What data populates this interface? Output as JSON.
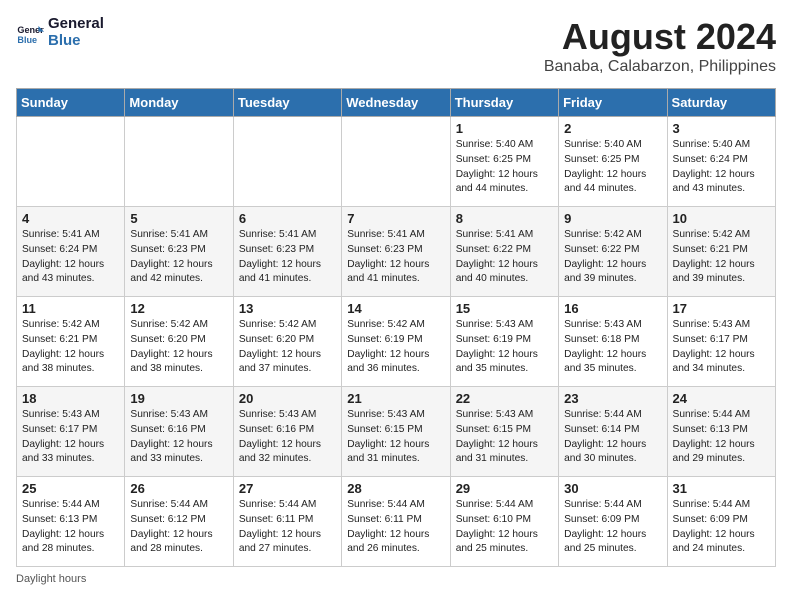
{
  "logo": {
    "line1": "General",
    "line2": "Blue"
  },
  "title": "August 2024",
  "subtitle": "Banaba, Calabarzon, Philippines",
  "footer": "Daylight hours",
  "days_of_week": [
    "Sunday",
    "Monday",
    "Tuesday",
    "Wednesday",
    "Thursday",
    "Friday",
    "Saturday"
  ],
  "weeks": [
    [
      {
        "day": "",
        "info": ""
      },
      {
        "day": "",
        "info": ""
      },
      {
        "day": "",
        "info": ""
      },
      {
        "day": "",
        "info": ""
      },
      {
        "day": "1",
        "info": "Sunrise: 5:40 AM\nSunset: 6:25 PM\nDaylight: 12 hours\nand 44 minutes."
      },
      {
        "day": "2",
        "info": "Sunrise: 5:40 AM\nSunset: 6:25 PM\nDaylight: 12 hours\nand 44 minutes."
      },
      {
        "day": "3",
        "info": "Sunrise: 5:40 AM\nSunset: 6:24 PM\nDaylight: 12 hours\nand 43 minutes."
      }
    ],
    [
      {
        "day": "4",
        "info": "Sunrise: 5:41 AM\nSunset: 6:24 PM\nDaylight: 12 hours\nand 43 minutes."
      },
      {
        "day": "5",
        "info": "Sunrise: 5:41 AM\nSunset: 6:23 PM\nDaylight: 12 hours\nand 42 minutes."
      },
      {
        "day": "6",
        "info": "Sunrise: 5:41 AM\nSunset: 6:23 PM\nDaylight: 12 hours\nand 41 minutes."
      },
      {
        "day": "7",
        "info": "Sunrise: 5:41 AM\nSunset: 6:23 PM\nDaylight: 12 hours\nand 41 minutes."
      },
      {
        "day": "8",
        "info": "Sunrise: 5:41 AM\nSunset: 6:22 PM\nDaylight: 12 hours\nand 40 minutes."
      },
      {
        "day": "9",
        "info": "Sunrise: 5:42 AM\nSunset: 6:22 PM\nDaylight: 12 hours\nand 39 minutes."
      },
      {
        "day": "10",
        "info": "Sunrise: 5:42 AM\nSunset: 6:21 PM\nDaylight: 12 hours\nand 39 minutes."
      }
    ],
    [
      {
        "day": "11",
        "info": "Sunrise: 5:42 AM\nSunset: 6:21 PM\nDaylight: 12 hours\nand 38 minutes."
      },
      {
        "day": "12",
        "info": "Sunrise: 5:42 AM\nSunset: 6:20 PM\nDaylight: 12 hours\nand 38 minutes."
      },
      {
        "day": "13",
        "info": "Sunrise: 5:42 AM\nSunset: 6:20 PM\nDaylight: 12 hours\nand 37 minutes."
      },
      {
        "day": "14",
        "info": "Sunrise: 5:42 AM\nSunset: 6:19 PM\nDaylight: 12 hours\nand 36 minutes."
      },
      {
        "day": "15",
        "info": "Sunrise: 5:43 AM\nSunset: 6:19 PM\nDaylight: 12 hours\nand 35 minutes."
      },
      {
        "day": "16",
        "info": "Sunrise: 5:43 AM\nSunset: 6:18 PM\nDaylight: 12 hours\nand 35 minutes."
      },
      {
        "day": "17",
        "info": "Sunrise: 5:43 AM\nSunset: 6:17 PM\nDaylight: 12 hours\nand 34 minutes."
      }
    ],
    [
      {
        "day": "18",
        "info": "Sunrise: 5:43 AM\nSunset: 6:17 PM\nDaylight: 12 hours\nand 33 minutes."
      },
      {
        "day": "19",
        "info": "Sunrise: 5:43 AM\nSunset: 6:16 PM\nDaylight: 12 hours\nand 33 minutes."
      },
      {
        "day": "20",
        "info": "Sunrise: 5:43 AM\nSunset: 6:16 PM\nDaylight: 12 hours\nand 32 minutes."
      },
      {
        "day": "21",
        "info": "Sunrise: 5:43 AM\nSunset: 6:15 PM\nDaylight: 12 hours\nand 31 minutes."
      },
      {
        "day": "22",
        "info": "Sunrise: 5:43 AM\nSunset: 6:15 PM\nDaylight: 12 hours\nand 31 minutes."
      },
      {
        "day": "23",
        "info": "Sunrise: 5:44 AM\nSunset: 6:14 PM\nDaylight: 12 hours\nand 30 minutes."
      },
      {
        "day": "24",
        "info": "Sunrise: 5:44 AM\nSunset: 6:13 PM\nDaylight: 12 hours\nand 29 minutes."
      }
    ],
    [
      {
        "day": "25",
        "info": "Sunrise: 5:44 AM\nSunset: 6:13 PM\nDaylight: 12 hours\nand 28 minutes."
      },
      {
        "day": "26",
        "info": "Sunrise: 5:44 AM\nSunset: 6:12 PM\nDaylight: 12 hours\nand 28 minutes."
      },
      {
        "day": "27",
        "info": "Sunrise: 5:44 AM\nSunset: 6:11 PM\nDaylight: 12 hours\nand 27 minutes."
      },
      {
        "day": "28",
        "info": "Sunrise: 5:44 AM\nSunset: 6:11 PM\nDaylight: 12 hours\nand 26 minutes."
      },
      {
        "day": "29",
        "info": "Sunrise: 5:44 AM\nSunset: 6:10 PM\nDaylight: 12 hours\nand 25 minutes."
      },
      {
        "day": "30",
        "info": "Sunrise: 5:44 AM\nSunset: 6:09 PM\nDaylight: 12 hours\nand 25 minutes."
      },
      {
        "day": "31",
        "info": "Sunrise: 5:44 AM\nSunset: 6:09 PM\nDaylight: 12 hours\nand 24 minutes."
      }
    ]
  ]
}
